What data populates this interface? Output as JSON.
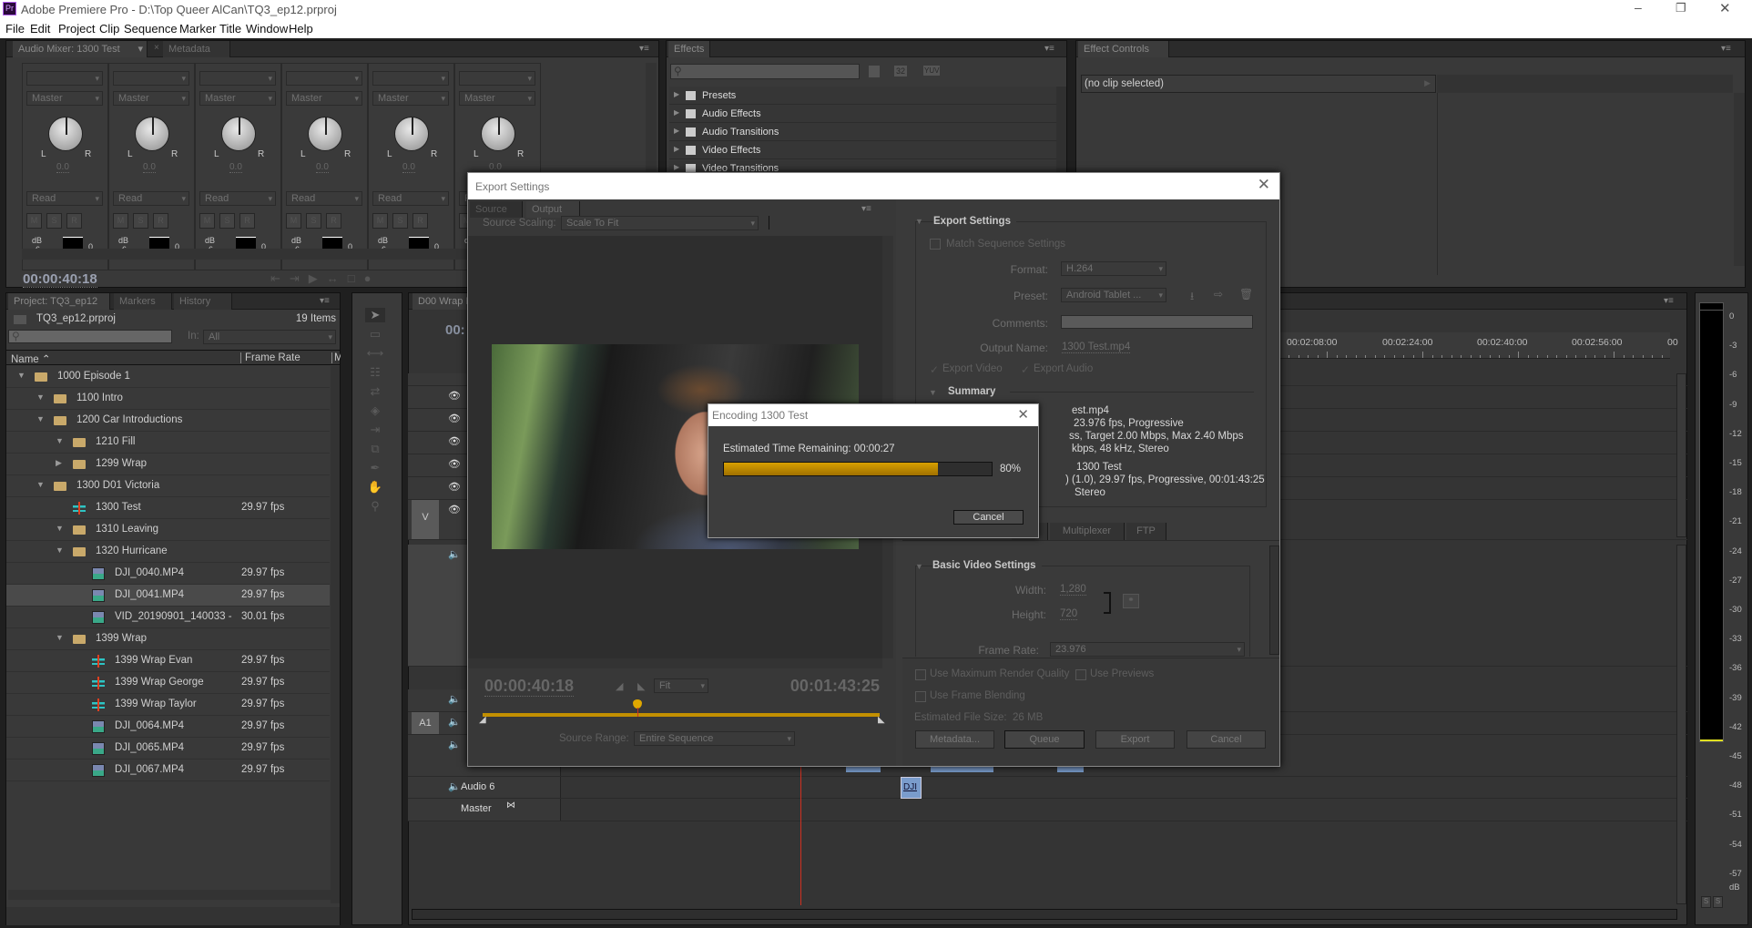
{
  "window": {
    "title": "Adobe Premiere Pro - D:\\Top Queer AlCan\\TQ3_ep12.prproj",
    "app_icon": "Pr",
    "controls": [
      "minimize-icon",
      "restore-icon",
      "close-icon"
    ]
  },
  "menu": [
    "File",
    "Edit",
    "Project",
    "Clip",
    "Sequence",
    "Marker",
    "Title",
    "Window",
    "Help"
  ],
  "audio_mixer": {
    "tab": "Audio Mixer: 1300 Test",
    "tab2": "Metadata",
    "strips": [
      {
        "output": "Master",
        "value": "0.0",
        "mode": "Read"
      },
      {
        "output": "Master",
        "value": "0.0",
        "mode": "Read"
      },
      {
        "output": "Master",
        "value": "0.0",
        "mode": "Read"
      },
      {
        "output": "Master",
        "value": "0.0",
        "mode": "Read"
      },
      {
        "output": "Master",
        "value": "0.0",
        "mode": "Read"
      },
      {
        "output": "Master",
        "value": "0.0",
        "mode": "Read"
      }
    ],
    "knob_l": "L",
    "knob_r": "R",
    "buttons": [
      "M",
      "S",
      "R"
    ],
    "db": "dB",
    "db6": "6",
    "db0": "0",
    "timecode": "00:00:40:18"
  },
  "effects": {
    "tab": "Effects",
    "badges": [
      "32",
      "YUV"
    ],
    "items": [
      "Presets",
      "Audio Effects",
      "Audio Transitions",
      "Video Effects",
      "Video Transitions"
    ]
  },
  "effect_controls": {
    "tab": "Effect Controls",
    "no_clip": "(no clip selected)"
  },
  "project": {
    "tabs": [
      "Project: TQ3_ep12",
      "Markers",
      "History"
    ],
    "file": "TQ3_ep12.prproj",
    "count": "19 Items",
    "in_label": "In:",
    "in_value": "All",
    "col_name": "Name",
    "col_rate": "Frame Rate",
    "col_more": "Me",
    "rows": [
      {
        "name": "1000 Episode 1",
        "level": 0,
        "type": "folder",
        "toggle": "open",
        "rate": ""
      },
      {
        "name": "1100 Intro",
        "level": 1,
        "type": "folder",
        "toggle": "open",
        "rate": ""
      },
      {
        "name": "1200 Car Introductions",
        "level": 1,
        "type": "folder",
        "toggle": "open",
        "rate": ""
      },
      {
        "name": "1210 Fill",
        "level": 2,
        "type": "folder",
        "toggle": "open",
        "rate": ""
      },
      {
        "name": "1299 Wrap",
        "level": 2,
        "type": "folder",
        "toggle": "closed",
        "rate": ""
      },
      {
        "name": "1300 D01 Victoria",
        "level": 1,
        "type": "folder",
        "toggle": "open",
        "rate": ""
      },
      {
        "name": "1300 Test",
        "level": 2,
        "type": "sequence",
        "toggle": "",
        "rate": "29.97 fps"
      },
      {
        "name": "1310 Leaving",
        "level": 2,
        "type": "folder",
        "toggle": "open",
        "rate": ""
      },
      {
        "name": "1320 Hurricane",
        "level": 2,
        "type": "folder",
        "toggle": "open",
        "rate": ""
      },
      {
        "name": "DJI_0040.MP4",
        "level": 3,
        "type": "clip",
        "toggle": "",
        "rate": "29.97 fps"
      },
      {
        "name": "DJI_0041.MP4",
        "level": 3,
        "type": "clip",
        "toggle": "",
        "rate": "29.97 fps",
        "selected": true
      },
      {
        "name": "VID_20190901_140033 -",
        "level": 3,
        "type": "clip",
        "toggle": "",
        "rate": "30.01 fps"
      },
      {
        "name": "1399 Wrap",
        "level": 2,
        "type": "folder",
        "toggle": "open",
        "rate": ""
      },
      {
        "name": "1399 Wrap Evan",
        "level": 3,
        "type": "sequence",
        "toggle": "",
        "rate": "29.97 fps"
      },
      {
        "name": "1399 Wrap George",
        "level": 3,
        "type": "sequence",
        "toggle": "",
        "rate": "29.97 fps"
      },
      {
        "name": "1399 Wrap Taylor",
        "level": 3,
        "type": "sequence",
        "toggle": "",
        "rate": "29.97 fps"
      },
      {
        "name": "DJI_0064.MP4",
        "level": 3,
        "type": "clip",
        "toggle": "",
        "rate": "29.97 fps"
      },
      {
        "name": "DJI_0065.MP4",
        "level": 3,
        "type": "clip",
        "toggle": "",
        "rate": "29.97 fps"
      },
      {
        "name": "DJI_0067.MP4",
        "level": 3,
        "type": "clip",
        "toggle": "",
        "rate": "29.97 fps"
      }
    ]
  },
  "timeline": {
    "tab": "D00 Wrap N",
    "timecode": "00:",
    "ruler": [
      "00:02:08:00",
      "00:02:24:00",
      "00:02:40:00",
      "00:02:56:00",
      "00"
    ],
    "v_target": "V",
    "a_target": "A1",
    "audio6": "Audio 6",
    "master": "Master",
    "clip_label": "DJI"
  },
  "meter": {
    "labels": [
      "0",
      "-3",
      "-6",
      "-9",
      "-12",
      "-15",
      "-18",
      "-21",
      "-24",
      "-27",
      "-30",
      "-33",
      "-36",
      "-39",
      "-42",
      "-45",
      "-48",
      "-51",
      "-54",
      "-57"
    ],
    "unit": "dB",
    "solo": [
      "S",
      "S"
    ]
  },
  "export": {
    "title": "Export Settings",
    "tabs": [
      "Source",
      "Output"
    ],
    "source_scaling_label": "Source Scaling:",
    "source_scaling": "Scale To Fit",
    "tc_current": "00:00:40:18",
    "tc_duration": "00:01:43:25",
    "zoom": "Fit",
    "source_range_label": "Source Range:",
    "source_range": "Entire Sequence",
    "settings_heading": "Export Settings",
    "match_seq": "Match Sequence Settings",
    "format_label": "Format:",
    "format": "H.264",
    "preset_label": "Preset:",
    "preset": "Android Tablet ...",
    "comments_label": "Comments:",
    "output_name_label": "Output Name:",
    "output_name": "1300 Test.mp4",
    "export_video": "Export Video",
    "export_audio": "Export Audio",
    "summary_heading": "Summary",
    "summary_visible": [
      "est.mp4",
      "23.976 fps, Progressive",
      "ss, Target 2.00 Mbps, Max 2.40 Mbps",
      "kbps, 48 kHz, Stereo",
      "1300 Test",
      ") (1.0), 29.97 fps, Progressive, 00:01:43:25",
      "Stereo"
    ],
    "lower_tabs": [
      "Multiplexer",
      "FTP"
    ],
    "basic_video": "Basic Video Settings",
    "width_label": "Width:",
    "width": "1,280",
    "height_label": "Height:",
    "height": "720",
    "frame_rate_label": "Frame Rate:",
    "frame_rate": "23.976",
    "max_quality": "Use Maximum Render Quality",
    "use_previews": "Use Previews",
    "frame_blending": "Use Frame Blending",
    "file_size": "Estimated File Size:  26 MB",
    "buttons": [
      "Metadata...",
      "Queue",
      "Export",
      "Cancel"
    ]
  },
  "encoding": {
    "title": "Encoding 1300 Test",
    "remaining": "Estimated Time Remaining: 00:00:27",
    "progress": 80,
    "progress_label": "80%",
    "cancel": "Cancel",
    "bar_color": "#c28f00"
  }
}
